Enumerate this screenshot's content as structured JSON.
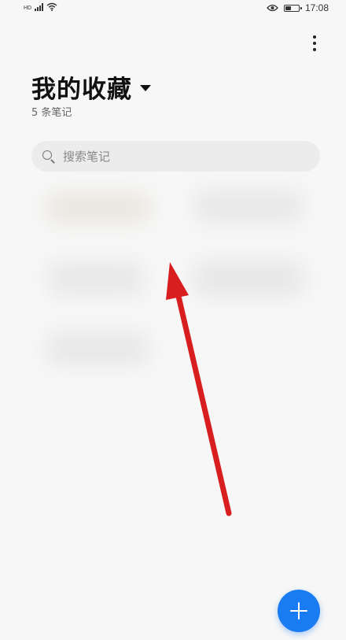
{
  "status_bar": {
    "signal_label": "HD",
    "time": "17:08",
    "battery_level": 0.45
  },
  "header": {
    "title": "我的收藏",
    "note_count": "5 条笔记"
  },
  "search": {
    "placeholder": "搜索笔记"
  },
  "icons": {
    "more": "more-vertical-icon",
    "dropdown": "caret-down-icon",
    "search": "search-icon",
    "add": "plus-icon",
    "wifi": "wifi-icon",
    "signal": "signal-icon",
    "eye": "eye-icon",
    "battery": "battery-icon"
  },
  "colors": {
    "accent": "#1a7cf2",
    "annotation": "#d81e1e",
    "background": "#f7f7f7",
    "search_bg": "#ececec"
  }
}
